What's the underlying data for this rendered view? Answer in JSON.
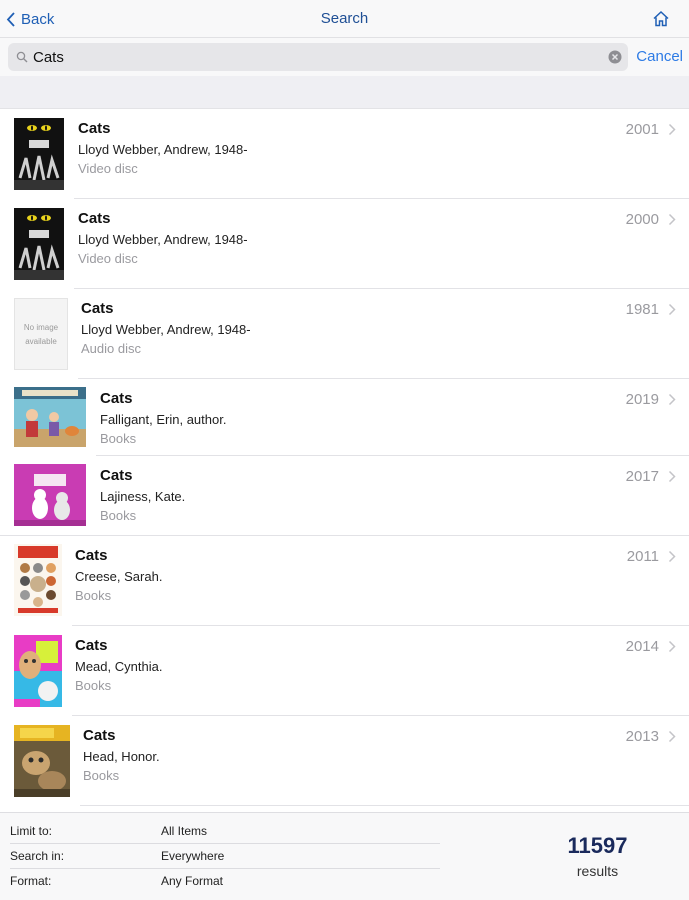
{
  "nav": {
    "back_label": "Back",
    "title": "Search"
  },
  "search": {
    "value": "Cats",
    "cancel_label": "Cancel"
  },
  "results": [
    {
      "title": "Cats",
      "author": "Lloyd Webber, Andrew, 1948-",
      "format": "Video disc",
      "year": "2001"
    },
    {
      "title": "Cats",
      "author": "Lloyd Webber, Andrew, 1948-",
      "format": "Video disc",
      "year": "2000"
    },
    {
      "title": "Cats",
      "author": "Lloyd Webber, Andrew, 1948-",
      "format": "Audio disc",
      "year": "1981",
      "no_image_text": "No image available"
    },
    {
      "title": "Cats",
      "author": "Falligant, Erin, author.",
      "format": "Books",
      "year": "2019"
    },
    {
      "title": "Cats",
      "author": "Lajiness, Kate.",
      "format": "Books",
      "year": "2017"
    },
    {
      "title": "Cats",
      "author": "Creese, Sarah.",
      "format": "Books",
      "year": "2011"
    },
    {
      "title": "Cats",
      "author": "Mead, Cynthia.",
      "format": "Books",
      "year": "2014"
    },
    {
      "title": "Cats",
      "author": "Head, Honor.",
      "format": "Books",
      "year": "2013"
    }
  ],
  "filters": [
    {
      "label": "Limit to:",
      "value": "All Items"
    },
    {
      "label": "Search in:",
      "value": "Everywhere"
    },
    {
      "label": "Format:",
      "value": "Any Format"
    }
  ],
  "summary": {
    "count": "11597",
    "label": "results"
  },
  "colors": {
    "accent": "#2d7be5",
    "nav_title": "#1f4f95",
    "muted": "#9a9a9f",
    "count": "#1a2a5c"
  }
}
